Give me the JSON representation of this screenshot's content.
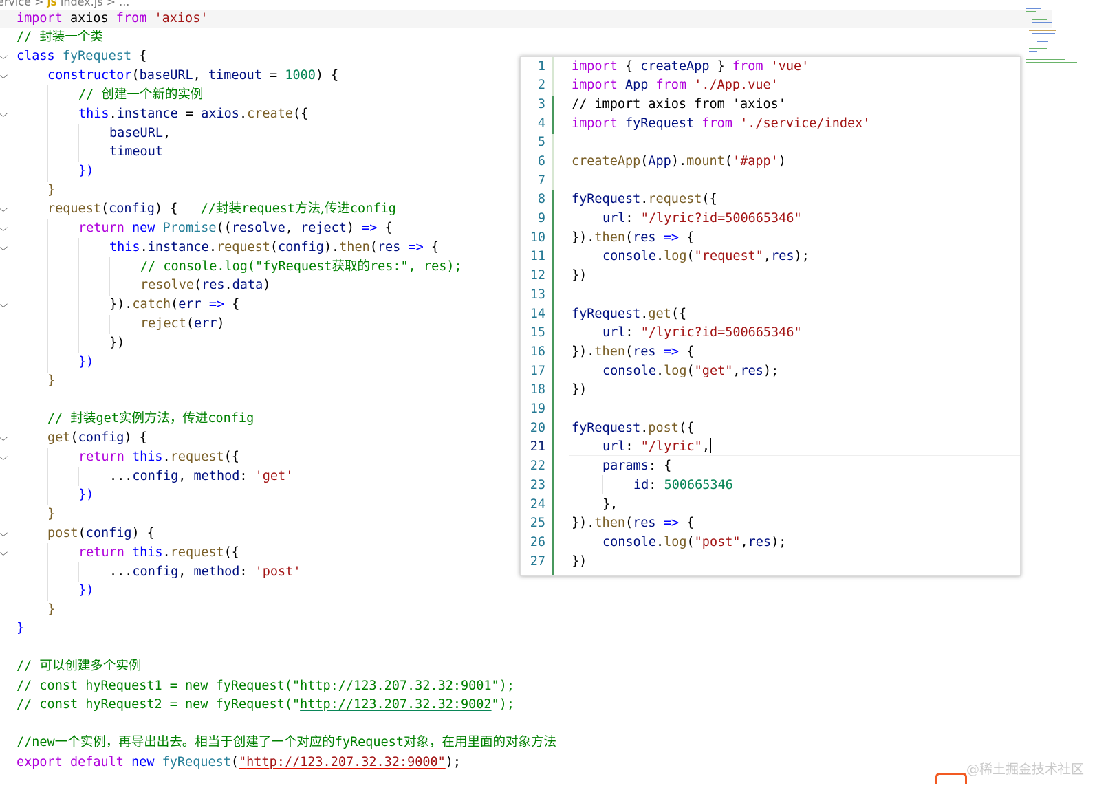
{
  "breadcrumb": {
    "segment": "ervice",
    "sep": ">",
    "file": "index.js",
    "more": "..."
  },
  "editor": {
    "lines": {
      "l1": {
        "k1": "import",
        "t1": " axios ",
        "k2": "from",
        "s1": "'axios'"
      },
      "l2": {
        "c1": "// ",
        "c2": "封装一个类"
      },
      "l3": {
        "b1": "class",
        "t1": " ",
        "ty": "fyRequest",
        "p": " {"
      },
      "l4": {
        "f1": "constructor",
        "p1": "(",
        "v1": "baseURL",
        "p2": ", ",
        "v2": "timeout",
        "p3": " = ",
        "n1": "1000",
        "p4": ") {"
      },
      "l5": {
        "c1": "// ",
        "c2": "创建一个新的实例"
      },
      "l6": {
        "b1": "this",
        "p1": ".",
        "v1": "instance",
        "p2": " = ",
        "v2": "axios",
        "p3": ".",
        "f1": "create",
        "p4": "({"
      },
      "l7": {
        "v1": "baseURL",
        "p1": ","
      },
      "l8": {
        "v1": "timeout"
      },
      "l9": {
        "p1": "})"
      },
      "l10": {
        "p1": "}"
      },
      "l11": {
        "f1": "request",
        "p1": "(",
        "v1": "config",
        "p2": ") {   ",
        "c1": "//",
        "c2": "封装",
        "c3": "request",
        "c4": "方法,传进",
        "c5": "config"
      },
      "l12": {
        "k1": "return",
        "p0": " ",
        "b1": "new",
        "p1": " ",
        "ty": "Promise",
        "p2": "((",
        "v1": "resolve",
        "p3": ", ",
        "v2": "reject",
        "p4": ") ",
        "b2": "=>",
        "p5": " {"
      },
      "l13": {
        "b1": "this",
        "p1": ".",
        "v1": "instance",
        "p2": ".",
        "f1": "request",
        "p3": "(",
        "v2": "config",
        "p4": ").",
        "f2": "then",
        "p5": "(",
        "v3": "res",
        "p6": " ",
        "b2": "=>",
        "p7": " {"
      },
      "l14": {
        "c1": "// console.log(\"fyRequest",
        "c2": "获取的",
        "c3": "res:\", res);"
      },
      "l15": {
        "f1": "resolve",
        "p1": "(",
        "v1": "res",
        "p2": ".",
        "v2": "data",
        "p3": ")"
      },
      "l16": {
        "p1": "}).",
        "f1": "catch",
        "p2": "(",
        "v1": "err",
        "p3": " ",
        "b1": "=>",
        "p4": " {"
      },
      "l17": {
        "f1": "reject",
        "p1": "(",
        "v1": "err",
        "p2": ")"
      },
      "l18": {
        "p1": "})"
      },
      "l19": {
        "p1": "})"
      },
      "l20": {
        "p1": "}"
      },
      "l22": {
        "c1": "// ",
        "c2": "封装",
        "c3": "get",
        "c4": "实例方法，传进",
        "c5": "config"
      },
      "l23": {
        "f1": "get",
        "p1": "(",
        "v1": "config",
        "p2": ") {"
      },
      "l24": {
        "k1": "return",
        "p0": " ",
        "b1": "this",
        "p1": ".",
        "f1": "request",
        "p2": "({"
      },
      "l25": {
        "p1": "...",
        "v1": "config",
        "p2": ", ",
        "v2": "method",
        "p3": ": ",
        "s1": "'get'"
      },
      "l26": {
        "p1": "})"
      },
      "l27": {
        "p1": "}"
      },
      "l28": {
        "f1": "post",
        "p1": "(",
        "v1": "config",
        "p2": ") {"
      },
      "l29": {
        "k1": "return",
        "p0": " ",
        "b1": "this",
        "p1": ".",
        "f1": "request",
        "p2": "({"
      },
      "l30": {
        "p1": "...",
        "v1": "config",
        "p2": ", ",
        "v2": "method",
        "p3": ": ",
        "s1": "'post'"
      },
      "l31": {
        "p1": "})"
      },
      "l32": {
        "p1": "}"
      },
      "l33": {
        "p1": "}"
      },
      "l35": {
        "c1": "// ",
        "c2": "可以创建多个实例"
      },
      "l36": {
        "c1": "// const hyRequest1 = new fyRequest(\"",
        "c2": "http://123.207.32.32:9001",
        "c3": "\");"
      },
      "l37": {
        "c1": "// const hyRequest2 = new fyRequest(\"",
        "c2": "http://123.207.32.32:9002",
        "c3": "\");"
      },
      "l39": {
        "c1": "//new",
        "c2": "一个实例，再导出出去。相当于创建了一个对应的",
        "c3": "fyRequest",
        "c4": "对象，在用里面的对象方法"
      },
      "l40": {
        "k1": "export",
        "p0": " ",
        "k2": "default",
        "p1": " ",
        "b1": "new",
        "p2": " ",
        "ty": "fyRequest",
        "p3": "(",
        "s1": "\"",
        "s2": "http://123.207.32.32:9000",
        "s3": "\"",
        "p4": ");"
      }
    }
  },
  "popup": {
    "line_numbers": [
      "1",
      "2",
      "3",
      "4",
      "5",
      "6",
      "7",
      "8",
      "9",
      "10",
      "11",
      "12",
      "13",
      "14",
      "15",
      "16",
      "17",
      "18",
      "19",
      "20",
      "21",
      "22",
      "23",
      "24",
      "25",
      "26",
      "27"
    ],
    "lines": {
      "r1": {
        "k1": "import",
        "p1": " { ",
        "v1": "createApp",
        "p2": " } ",
        "k2": "from",
        "p3": " ",
        "s1": "'vue'"
      },
      "r2": {
        "k1": "import",
        "p1": " ",
        "v1": "App",
        "p2": " ",
        "k2": "from",
        "p3": " ",
        "s1": "'./App.vue'"
      },
      "r3": {
        "c1": "// import axios from 'axios'"
      },
      "r4": {
        "k1": "import",
        "p1": " ",
        "v1": "fyRequest",
        "p2": " ",
        "k2": "from",
        "p3": " ",
        "s1": "'./service/index'"
      },
      "r6": {
        "f1": "createApp",
        "p1": "(",
        "v1": "App",
        "p2": ").",
        "f2": "mount",
        "p3": "(",
        "s1": "'#app'",
        "p4": ")"
      },
      "r8": {
        "v1": "fyRequest",
        "p1": ".",
        "f1": "request",
        "p2": "({"
      },
      "r9": {
        "v1": "url",
        "p1": ": ",
        "s1": "\"/lyric?id=500665346\""
      },
      "r10": {
        "p1": "}).",
        "f1": "then",
        "p2": "(",
        "v1": "res",
        "p3": " ",
        "b1": "=>",
        "p4": " {"
      },
      "r11": {
        "v1": "console",
        "p1": ".",
        "f1": "log",
        "p2": "(",
        "s1": "\"request\"",
        "p3": ",",
        "v2": "res",
        "p4": ");"
      },
      "r12": {
        "p1": "})"
      },
      "r14": {
        "v1": "fyRequest",
        "p1": ".",
        "f1": "get",
        "p2": "({"
      },
      "r15": {
        "v1": "url",
        "p1": ": ",
        "s1": "\"/lyric?id=500665346\""
      },
      "r16": {
        "p1": "}).",
        "f1": "then",
        "p2": "(",
        "v1": "res",
        "p3": " ",
        "b1": "=>",
        "p4": " {"
      },
      "r17": {
        "v1": "console",
        "p1": ".",
        "f1": "log",
        "p2": "(",
        "s1": "\"get\"",
        "p3": ",",
        "v2": "res",
        "p4": ");"
      },
      "r18": {
        "p1": "})"
      },
      "r20": {
        "v1": "fyRequest",
        "p1": ".",
        "f1": "post",
        "p2": "({"
      },
      "r21": {
        "v1": "url",
        "p1": ": ",
        "s1": "\"/lyric\"",
        "p2": ","
      },
      "r22": {
        "v1": "params",
        "p1": ": {"
      },
      "r23": {
        "v1": "id",
        "p1": ": ",
        "n1": "500665346"
      },
      "r24": {
        "p1": "},"
      },
      "r25": {
        "p1": "}).",
        "f1": "then",
        "p2": "(",
        "v1": "res",
        "p3": " ",
        "b1": "=>",
        "p4": " {"
      },
      "r26": {
        "v1": "console",
        "p1": ".",
        "f1": "log",
        "p2": "(",
        "s1": "\"post\"",
        "p3": ",",
        "v2": "res",
        "p4": ");"
      },
      "r27": {
        "p1": "})"
      }
    }
  },
  "watermark": {
    "text": "@稀土掘金技术社区"
  },
  "colors": {
    "keyword": "#af00db",
    "storage": "#0000ff",
    "function": "#795e26",
    "variable": "#001080",
    "type": "#267f99",
    "string": "#a31515",
    "number": "#098658",
    "comment": "#008000",
    "line_number": "#237893",
    "git_added": "#48985d"
  }
}
